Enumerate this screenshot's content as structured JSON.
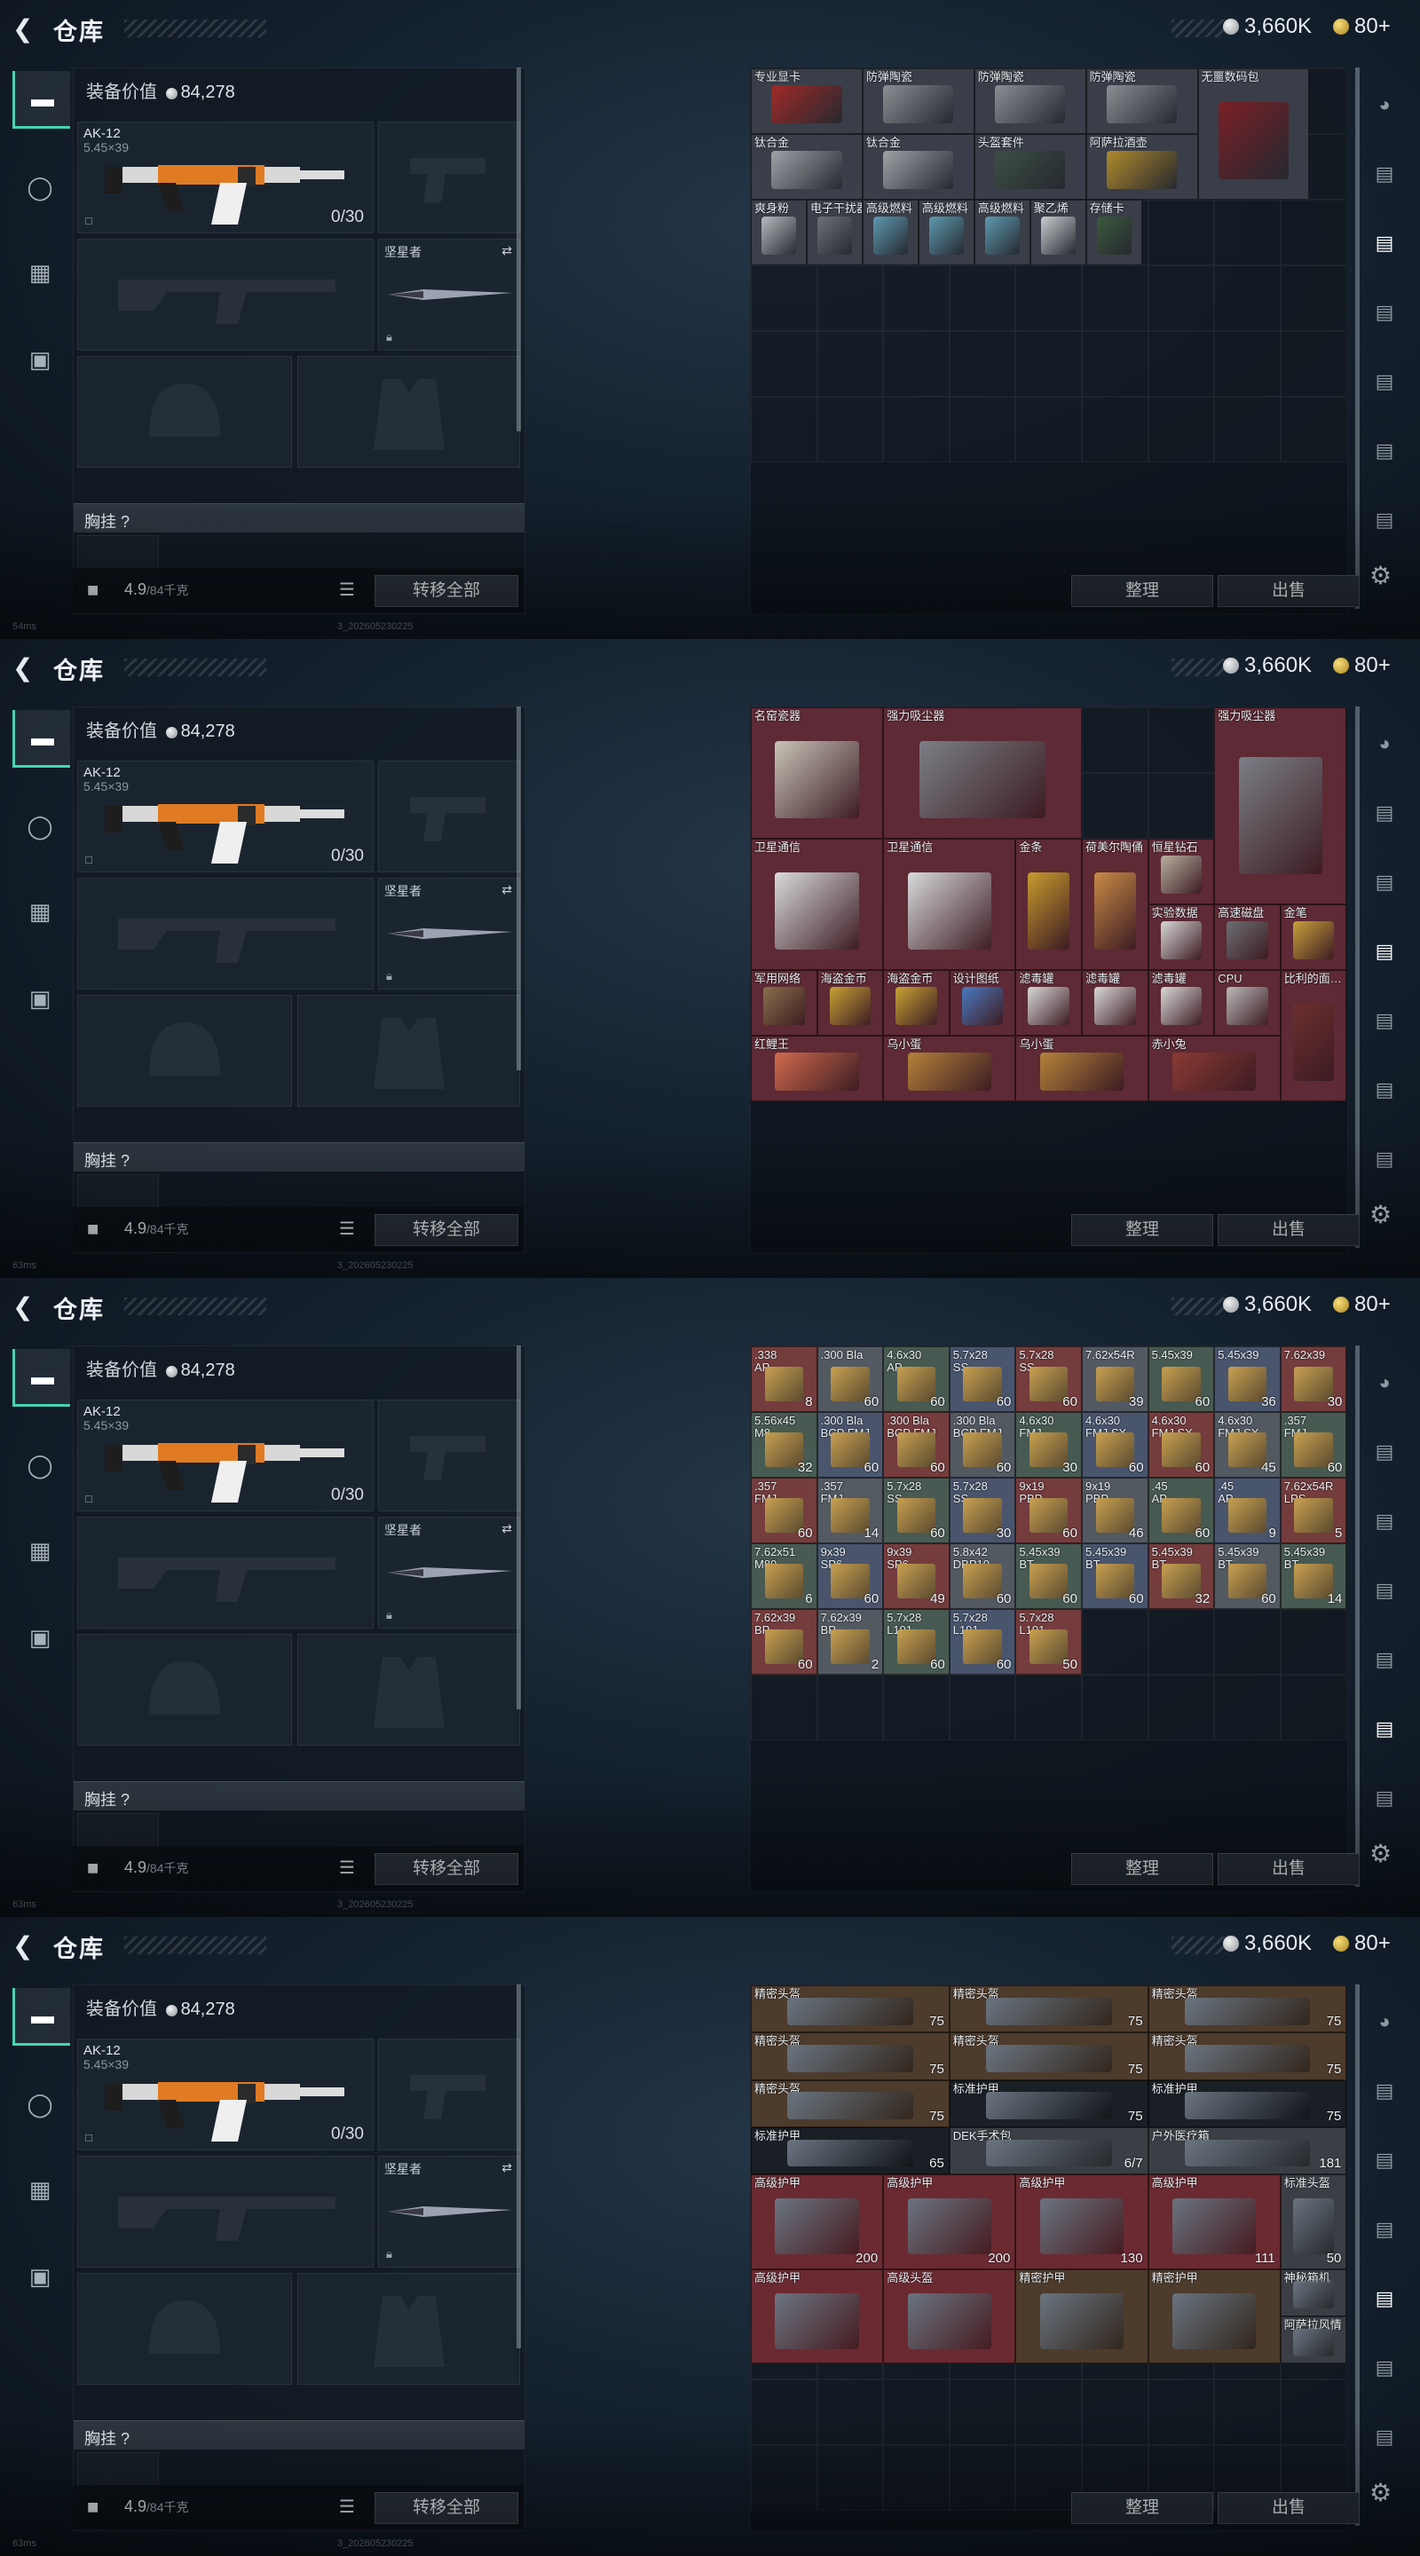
{
  "colors": {
    "accent": "#43d6b6",
    "coin_silver": "#c8ccd0",
    "coin_gold": "#d9b23a"
  },
  "header": {
    "title": "仓库",
    "silver": "3,660K",
    "gold": "80+"
  },
  "loadout": {
    "value_label": "装备价值",
    "value": "84,278",
    "weapon_name": "AK-12",
    "weapon_sub": "5.45×39",
    "ammo": "0/30",
    "melee_label": "坚星者",
    "chest_label": "胸挂 ?",
    "weight": "4.9",
    "weight_max": "/84千克",
    "transfer_label": "转移全部"
  },
  "storage": {
    "sort_label": "整理",
    "sell_label": "出售"
  },
  "status": {
    "p1": "54ms",
    "p2": "63ms",
    "p3": "63ms",
    "p4": "63ms"
  },
  "build": "3_202605230225",
  "page1": {
    "items": [
      {
        "name": "专业显卡",
        "color": "#a02a27"
      },
      {
        "name": "防弹陶瓷",
        "color": "#8a8f94"
      },
      {
        "name": "防弹陶瓷",
        "color": "#8a8f94"
      },
      {
        "name": "防弹陶瓷",
        "color": "#8a8f94"
      },
      {
        "name": "无噩数码包",
        "color": "#7a1f26"
      },
      {
        "name": "钛合金",
        "color": "#9ea3a8"
      },
      {
        "name": "钛合金",
        "color": "#9ea3a8"
      },
      {
        "name": "头盔套件",
        "color": "#3d4f44"
      },
      {
        "name": "阿萨拉酒壶",
        "color": "#b08a2c"
      },
      {
        "name": "爽身粉",
        "color": "#b7bcc0"
      },
      {
        "name": "电子干扰器",
        "color": "#6c7277"
      },
      {
        "name": "高级燃料",
        "color": "#5d9ab0"
      },
      {
        "name": "高级燃料",
        "color": "#5d9ab0"
      },
      {
        "name": "高级燃料",
        "color": "#5d9ab0"
      },
      {
        "name": "聚乙烯",
        "color": "#c9cdd0"
      },
      {
        "name": "存储卡",
        "color": "#3e5a3e"
      }
    ]
  },
  "page2": {
    "items": [
      {
        "name": "名窑瓷器",
        "color": "#c8c4b8"
      },
      {
        "name": "强力吸尘器",
        "color": "#7a7f85"
      },
      {
        "name": "强力吸尘器",
        "color": "#7a7f85"
      },
      {
        "name": "卫星通信",
        "color": "#d8dadc"
      },
      {
        "name": "卫星通信",
        "color": "#d8dadc"
      },
      {
        "name": "金条",
        "color": "#c79a2e"
      },
      {
        "name": "荷美尔陶俑",
        "color": "#c78a46"
      },
      {
        "name": "恒星钻石",
        "color": "#b8b0a0"
      },
      {
        "name": "实验数据",
        "color": "#d7d7d7"
      },
      {
        "name": "高速磁盘",
        "color": "#6b6f73"
      },
      {
        "name": "金笔",
        "color": "#c8a03a"
      },
      {
        "name": "军用网络",
        "color": "#8a6f4a"
      },
      {
        "name": "海盗金币",
        "color": "#c7a234"
      },
      {
        "name": "海盗金币",
        "color": "#c7a234"
      },
      {
        "name": "设计图纸",
        "color": "#4a7ac0"
      },
      {
        "name": "滤毒罐",
        "color": "#d9d9d9"
      },
      {
        "name": "滤毒罐",
        "color": "#d9d9d9"
      },
      {
        "name": "滤毒罐",
        "color": "#d9d9d9"
      },
      {
        "name": "CPU",
        "color": "#b9b9b9"
      },
      {
        "name": "比利的面…",
        "color": "#6b2f2f"
      },
      {
        "name": "红鲤王",
        "color": "#d06b4d"
      },
      {
        "name": "乌小蛋",
        "color": "#b4823a"
      },
      {
        "name": "乌小蛋",
        "color": "#b4823a"
      },
      {
        "name": "赤小兔",
        "color": "#8a3a34"
      }
    ]
  },
  "page3": {
    "items": [
      {
        "name": ".338",
        "sub": "AP",
        "qty": "8"
      },
      {
        "name": ".300 Bla",
        "sub": "",
        "qty": "60"
      },
      {
        "name": "4.6x30",
        "sub": "AP",
        "qty": "60"
      },
      {
        "name": "5.7x28",
        "sub": "SS",
        "qty": "60"
      },
      {
        "name": "5.7x28",
        "sub": "SS",
        "qty": "60"
      },
      {
        "name": "7.62x54R",
        "sub": "",
        "qty": "39"
      },
      {
        "name": "5.45x39",
        "sub": "",
        "qty": "60"
      },
      {
        "name": "5.45x39",
        "sub": "",
        "qty": "36"
      },
      {
        "name": "7.62x39",
        "sub": "",
        "qty": "30"
      },
      {
        "name": "5.56x45",
        "sub": "M8",
        "qty": "32"
      },
      {
        "name": ".300 Bla",
        "sub": "BCP FMJ",
        "qty": "60"
      },
      {
        "name": ".300 Bla",
        "sub": "BCP FMJ",
        "qty": "60"
      },
      {
        "name": ".300 Bla",
        "sub": "BCP FMJ",
        "qty": "60"
      },
      {
        "name": "4.6x30",
        "sub": "FMJ",
        "qty": "30"
      },
      {
        "name": "4.6x30",
        "sub": "FMJ SX",
        "qty": "60"
      },
      {
        "name": "4.6x30",
        "sub": "FMJ SX",
        "qty": "60"
      },
      {
        "name": "4.6x30",
        "sub": "FMJ SX",
        "qty": "45"
      },
      {
        "name": ".357",
        "sub": "FMJ",
        "qty": "60"
      },
      {
        "name": ".357",
        "sub": "FMJ",
        "qty": "60"
      },
      {
        "name": ".357",
        "sub": "FMJ",
        "qty": "14"
      },
      {
        "name": "5.7x28",
        "sub": "SS",
        "qty": "60"
      },
      {
        "name": "5.7x28",
        "sub": "SS",
        "qty": "30"
      },
      {
        "name": "9x19",
        "sub": "PBP",
        "qty": "60"
      },
      {
        "name": "9x19",
        "sub": "PBP",
        "qty": "46"
      },
      {
        "name": ".45",
        "sub": "AP",
        "qty": "60"
      },
      {
        "name": ".45",
        "sub": "AP",
        "qty": "9"
      },
      {
        "name": "7.62x54R",
        "sub": "LPS",
        "qty": "5"
      },
      {
        "name": "7.62x51",
        "sub": "M80",
        "qty": "6"
      },
      {
        "name": "9x39",
        "sub": "SP6",
        "qty": "60"
      },
      {
        "name": "9x39",
        "sub": "SP6",
        "qty": "49"
      },
      {
        "name": "5.8x42",
        "sub": "DBP10",
        "qty": "60"
      },
      {
        "name": "5.45x39",
        "sub": "BT",
        "qty": "60"
      },
      {
        "name": "5.45x39",
        "sub": "BT",
        "qty": "60"
      },
      {
        "name": "5.45x39",
        "sub": "BT",
        "qty": "32"
      },
      {
        "name": "5.45x39",
        "sub": "BT",
        "qty": "60"
      },
      {
        "name": "5.45x39",
        "sub": "BT",
        "qty": "14"
      },
      {
        "name": "7.62x39",
        "sub": "BP",
        "qty": "60"
      },
      {
        "name": "7.62x39",
        "sub": "BP",
        "qty": "2"
      },
      {
        "name": "5.7x28",
        "sub": "L191",
        "qty": "60"
      },
      {
        "name": "5.7x28",
        "sub": "L191",
        "qty": "60"
      },
      {
        "name": "5.7x28",
        "sub": "L191",
        "qty": "50"
      }
    ]
  },
  "page4": {
    "items": [
      {
        "name": "精密头盔",
        "qty": "75",
        "color": "#4d3b2c"
      },
      {
        "name": "精密头盔",
        "qty": "75",
        "color": "#4d3b2c"
      },
      {
        "name": "精密头盔",
        "qty": "75",
        "color": "#4d3b2c"
      },
      {
        "name": "精密头盔",
        "qty": "75",
        "color": "#4d3b2c"
      },
      {
        "name": "精密头盔",
        "qty": "75",
        "color": "#4d3b2c"
      },
      {
        "name": "精密头盔",
        "qty": "75",
        "color": "#4d3b2c"
      },
      {
        "name": "精密头盔",
        "qty": "75",
        "color": "#4d3b2c"
      },
      {
        "name": "标准护甲",
        "qty": "75",
        "color": "#1a1f26"
      },
      {
        "name": "标准护甲",
        "qty": "75",
        "color": "#1a1f26"
      },
      {
        "name": "标准护甲",
        "qty": "65",
        "color": "#1a1f26"
      },
      {
        "name": "DEK手术包",
        "qty": "6/7",
        "color": "#3b3f45"
      },
      {
        "name": "户外医疗箱",
        "qty": "181",
        "color": "#3b3f45"
      },
      {
        "name": "高级护甲",
        "qty": "200",
        "color": "#6b2a32"
      },
      {
        "name": "高级护甲",
        "qty": "200",
        "color": "#6b2a32"
      },
      {
        "name": "高级护甲",
        "qty": "130",
        "color": "#6b2a32"
      },
      {
        "name": "高级护甲",
        "qty": "111",
        "color": "#6b2a32"
      },
      {
        "name": "标准头盔",
        "qty": "50",
        "color": "#3b3f45"
      },
      {
        "name": "高级护甲",
        "qty": "",
        "color": "#6b2a32"
      },
      {
        "name": "高级头盔",
        "qty": "",
        "color": "#6b2a32"
      },
      {
        "name": "精密护甲",
        "qty": "",
        "color": "#4d3b2c"
      },
      {
        "name": "精密护甲",
        "qty": "",
        "color": "#4d3b2c"
      },
      {
        "name": "神秘箱机",
        "qty": "",
        "color": "#3b3f45"
      },
      {
        "name": "阿萨拉风情",
        "qty": "",
        "color": "#3b3f45"
      }
    ]
  }
}
